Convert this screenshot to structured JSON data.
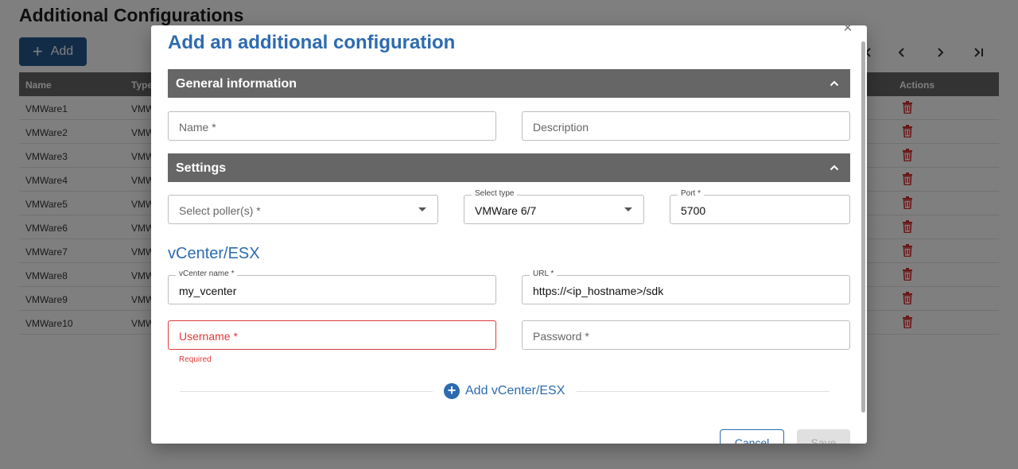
{
  "background": {
    "page_title": "Additional Configurations",
    "add_label": "Add",
    "table": {
      "headers": [
        "Name",
        "Type",
        "Actions"
      ],
      "rows": [
        {
          "name": "VMWare1",
          "type": "VMW"
        },
        {
          "name": "VMWare2",
          "type": "VMW"
        },
        {
          "name": "VMWare3",
          "type": "VMW"
        },
        {
          "name": "VMWare4",
          "type": "VMW"
        },
        {
          "name": "VMWare5",
          "type": "VMW"
        },
        {
          "name": "VMWare6",
          "type": "VMW"
        },
        {
          "name": "VMWare7",
          "type": "VMW"
        },
        {
          "name": "VMWare8",
          "type": "VMW"
        },
        {
          "name": "VMWare9",
          "type": "VMW"
        },
        {
          "name": "VMWare10",
          "type": "VMW"
        }
      ]
    },
    "pager_icons": [
      "first-page-icon",
      "chevron-left-icon",
      "chevron-right-icon",
      "last-page-icon"
    ]
  },
  "dialog": {
    "title": "Add an additional configuration",
    "close_icon": "close-icon",
    "general_section": {
      "title": "General information",
      "name_placeholder": "Name *",
      "description_placeholder": "Description"
    },
    "settings_section": {
      "title": "Settings",
      "poller_placeholder": "Select poller(s) *",
      "type_label": "Select type",
      "type_value": "VMWare 6/7",
      "port_label": "Port *",
      "port_value": "5700"
    },
    "vcenter": {
      "heading": "vCenter/ESX",
      "name_label": "vCenter name *",
      "name_value": "my_vcenter",
      "url_label": "URL *",
      "url_value": "https://<ip_hostname>/sdk",
      "username_placeholder": "Username *",
      "username_error": "Required",
      "password_placeholder": "Password *",
      "add_label": "Add vCenter/ESX"
    },
    "buttons": {
      "cancel": "Cancel",
      "save": "Save"
    }
  },
  "colors": {
    "accent": "#2d6bb0",
    "header_gray": "#666666",
    "error": "#e03a3a",
    "delete": "#d32f2f"
  }
}
